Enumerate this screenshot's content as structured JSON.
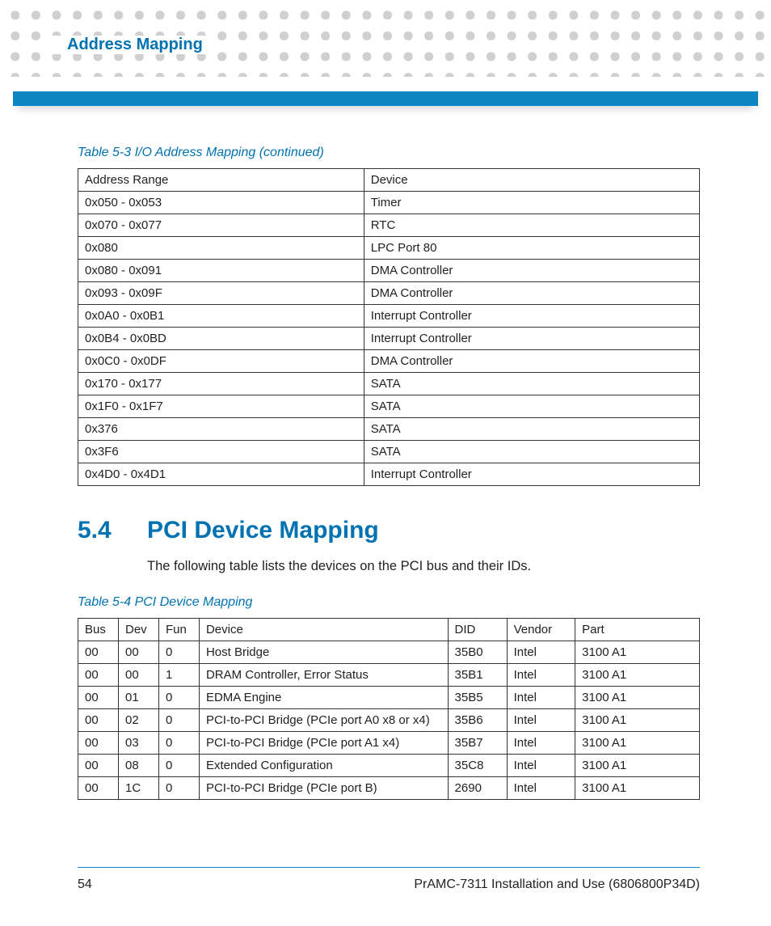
{
  "header": {
    "title": "Address Mapping"
  },
  "table1": {
    "caption": "Table 5-3 I/O Address Mapping (continued)",
    "headers": [
      "Address Range",
      "Device"
    ],
    "rows": [
      {
        "range": "0x050 - 0x053",
        "device": "Timer"
      },
      {
        "range": "0x070 - 0x077",
        "device": "RTC"
      },
      {
        "range": "0x080",
        "device": "LPC Port 80"
      },
      {
        "range": "0x080 - 0x091",
        "device": "DMA Controller"
      },
      {
        "range": "0x093 - 0x09F",
        "device": "DMA Controller"
      },
      {
        "range": "0x0A0 - 0x0B1",
        "device": "Interrupt Controller"
      },
      {
        "range": "0x0B4 - 0x0BD",
        "device": "Interrupt Controller"
      },
      {
        "range": "0x0C0 - 0x0DF",
        "device": "DMA Controller"
      },
      {
        "range": "0x170 - 0x177",
        "device": "SATA"
      },
      {
        "range": "0x1F0 - 0x1F7",
        "device": "SATA"
      },
      {
        "range": "0x376",
        "device": "SATA"
      },
      {
        "range": "0x3F6",
        "device": "SATA"
      },
      {
        "range": "0x4D0 - 0x4D1",
        "device": "Interrupt Controller"
      }
    ]
  },
  "section": {
    "number": "5.4",
    "title": "PCI Device Mapping",
    "intro": "The following table lists the devices on the PCI bus and their IDs."
  },
  "table2": {
    "caption": "Table 5-4 PCI Device Mapping",
    "headers": [
      "Bus",
      "Dev",
      "Fun",
      "Device",
      "DID",
      "Vendor",
      "Part"
    ],
    "rows": [
      {
        "bus": "00",
        "dev": "00",
        "fun": "0",
        "device": "Host Bridge",
        "did": "35B0",
        "vendor": "Intel",
        "part": "3100 A1"
      },
      {
        "bus": "00",
        "dev": "00",
        "fun": "1",
        "device": "DRAM Controller, Error Status",
        "did": "35B1",
        "vendor": "Intel",
        "part": "3100 A1"
      },
      {
        "bus": "00",
        "dev": "01",
        "fun": "0",
        "device": "EDMA Engine",
        "did": "35B5",
        "vendor": "Intel",
        "part": "3100 A1"
      },
      {
        "bus": "00",
        "dev": "02",
        "fun": "0",
        "device": "PCI-to-PCI Bridge (PCIe port A0 x8 or x4)",
        "did": "35B6",
        "vendor": "Intel",
        "part": "3100 A1"
      },
      {
        "bus": "00",
        "dev": "03",
        "fun": "0",
        "device": "PCI-to-PCI Bridge (PCIe port A1 x4)",
        "did": "35B7",
        "vendor": "Intel",
        "part": "3100 A1"
      },
      {
        "bus": "00",
        "dev": "08",
        "fun": "0",
        "device": "Extended Configuration",
        "did": "35C8",
        "vendor": "Intel",
        "part": "3100 A1"
      },
      {
        "bus": "00",
        "dev": "1C",
        "fun": "0",
        "device": "PCI-to-PCI Bridge (PCIe port B)",
        "did": "2690",
        "vendor": "Intel",
        "part": "3100 A1"
      }
    ]
  },
  "footer": {
    "page": "54",
    "doc": "PrAMC-7311 Installation and Use (6806800P34D)"
  }
}
